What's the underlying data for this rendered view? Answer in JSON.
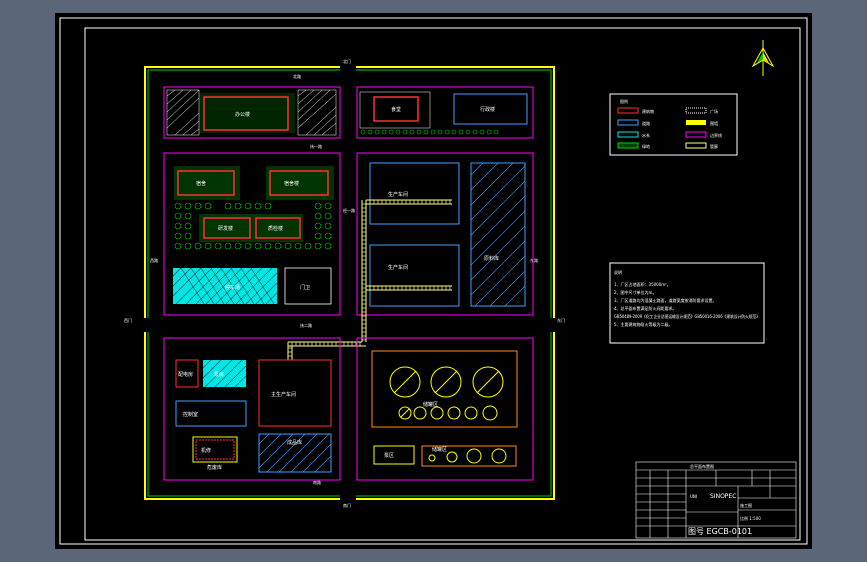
{
  "plan": {
    "gate_north": "北门",
    "gate_south": "南门",
    "gate_west": "西门",
    "gate_east": "东门",
    "road_north": "北路",
    "road_south": "南路",
    "road_mid_left": "纬一路",
    "road_mid_right": "纬二路",
    "road_west": "西路",
    "road_east": "东路",
    "road_center": "经一路",
    "zone_green_top": "办公楼",
    "zone_canteen": "食堂",
    "zone_admin": "行政楼",
    "zone_bld_a": "宿舍",
    "zone_bld_b": "宿舍楼",
    "zone_lab1": "研发楼",
    "zone_lab2": "质检楼",
    "zone_parking": "停车场",
    "zone_guard": "门卫",
    "zone_workshop1": "生产车间",
    "zone_workshop2": "生产车间",
    "zone_warehouse": "原料库",
    "zone_s1": "配电房",
    "zone_s2": "泵房",
    "zone_s3": "控制室",
    "zone_s4": "主生产车间",
    "zone_s5": "机修",
    "zone_s6": "危废库",
    "zone_s7": "成品库",
    "zone_tanks": "储罐区",
    "zone_pump": "泵区",
    "zone_tank_small": "储罐区"
  },
  "legend": {
    "title": "图例",
    "items": [
      {
        "label": "建筑物",
        "color": "#ff3030"
      },
      {
        "label": "道路",
        "color": "#3da0ff"
      },
      {
        "label": "水系",
        "color": "#00e5e5"
      },
      {
        "label": "绿地",
        "color": "#00d000"
      },
      {
        "label": "广场",
        "color": "#ffffff"
      },
      {
        "label": "围墙",
        "color": "#ffff00"
      },
      {
        "label": "边界线",
        "color": "#ff00ff"
      },
      {
        "label": "管廊",
        "color": "#ffff80"
      }
    ]
  },
  "notes": {
    "title": "说明",
    "lines": [
      "1、厂区占地面积：35000m²。",
      "2、图中尺寸单位为m。",
      "3、厂区道路均为混凝土路面，道路宽度按消防要求设置。",
      "4、总平面布置满足防火间距要求。",
      "GB50489-2009《化工企业总图运输设计规范》GB50016-2006《建筑设计防火规范》",
      "5、主要建筑物耐火等级为二级。"
    ]
  },
  "title_block": {
    "header": "总平面布置图",
    "company": "SINOPEC",
    "unit": "UNI",
    "drawing_no": "图号 EGCB-0101",
    "sheet": "比例 1:500",
    "stage": "施工图"
  },
  "colors": {
    "frame": "#ffffff",
    "wall": "#ffff00",
    "boundary": "#ff00ff",
    "building": "#ff3030",
    "road": "#3da0ff",
    "green": "#00d000",
    "water": "#00e5e5",
    "equipment": "#ff8c1a"
  }
}
